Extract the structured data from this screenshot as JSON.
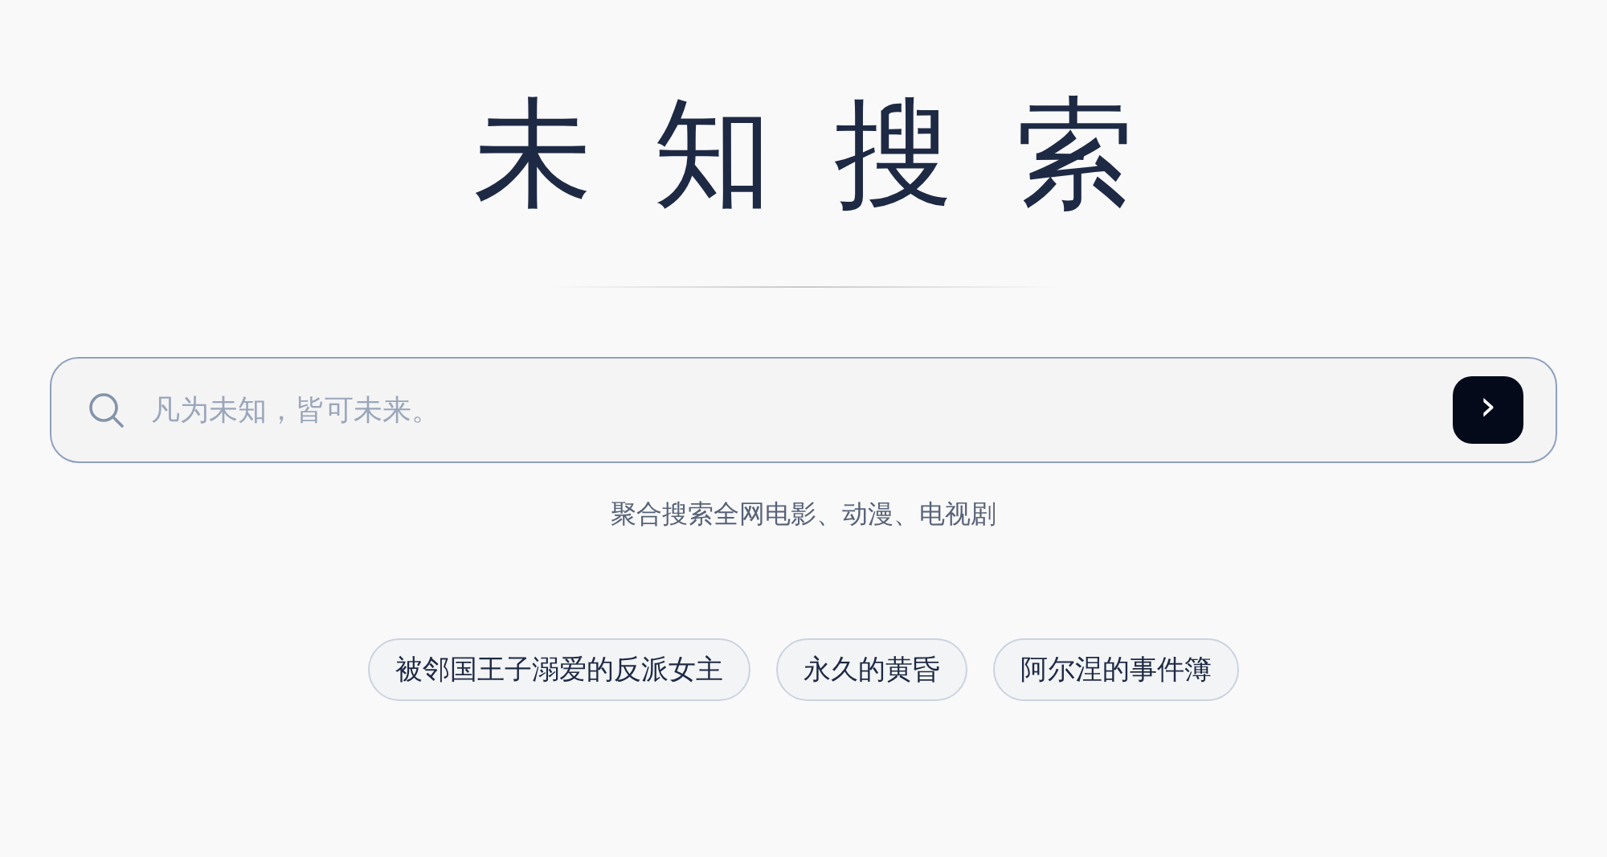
{
  "title": "未知搜索",
  "search": {
    "placeholder": "凡为未知，皆可未来。",
    "submit": "›"
  },
  "subtitle": "聚合搜索全网电影、动漫、电视剧",
  "suggestions": [
    "被邻国王子溺爱的反派女主",
    "永久的黄昏",
    "阿尔涅的事件簿"
  ]
}
